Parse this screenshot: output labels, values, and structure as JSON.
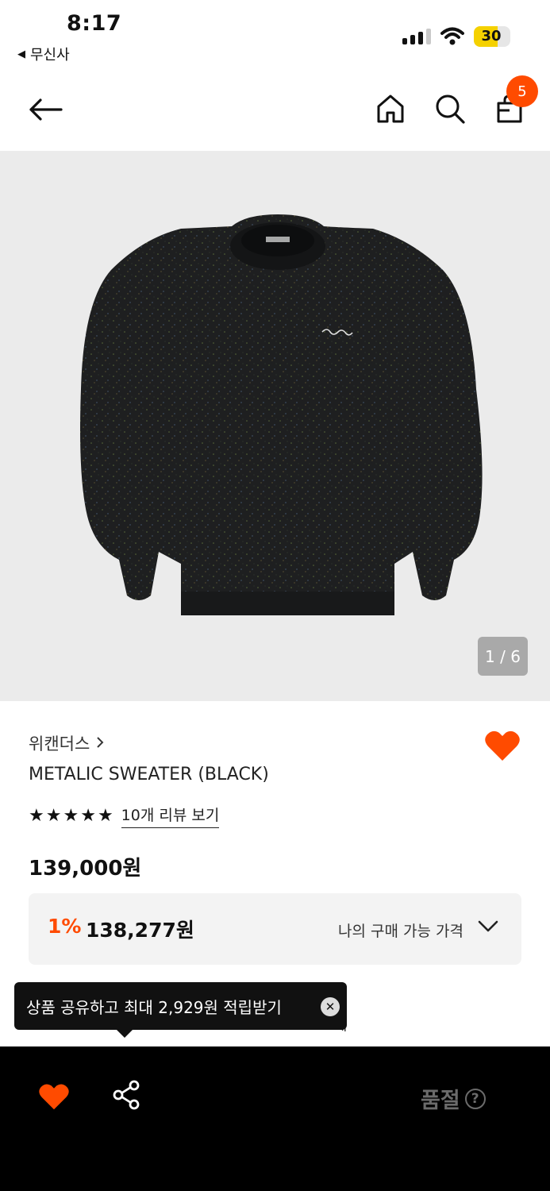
{
  "status_bar": {
    "time": "8:17",
    "back_app": "무신사",
    "battery": "30"
  },
  "header": {
    "cart_count": "5",
    "icons": [
      "back-arrow-icon",
      "home-icon",
      "search-icon",
      "shopping-bag-icon"
    ]
  },
  "product": {
    "image_counter": "1 / 6",
    "brand": "위캔더스",
    "name": "METALIC SWEATER (BLACK)",
    "rating_stars": 5,
    "review_link": "10개 리뷰 보기",
    "price": "139,000원",
    "my_price": {
      "discount": "1%",
      "price": "138,277원",
      "label": "나의 구매 가능 가격"
    },
    "partial_text": "혜"
  },
  "tooltip": {
    "message": "상품 공유하고 최대 2,929원 적립받기"
  },
  "bottom_bar": {
    "sold_out_label": "품절"
  },
  "colors": {
    "accent": "#ff4b00",
    "image_bg": "#ebebeb",
    "bottom_bar": "#000000"
  }
}
